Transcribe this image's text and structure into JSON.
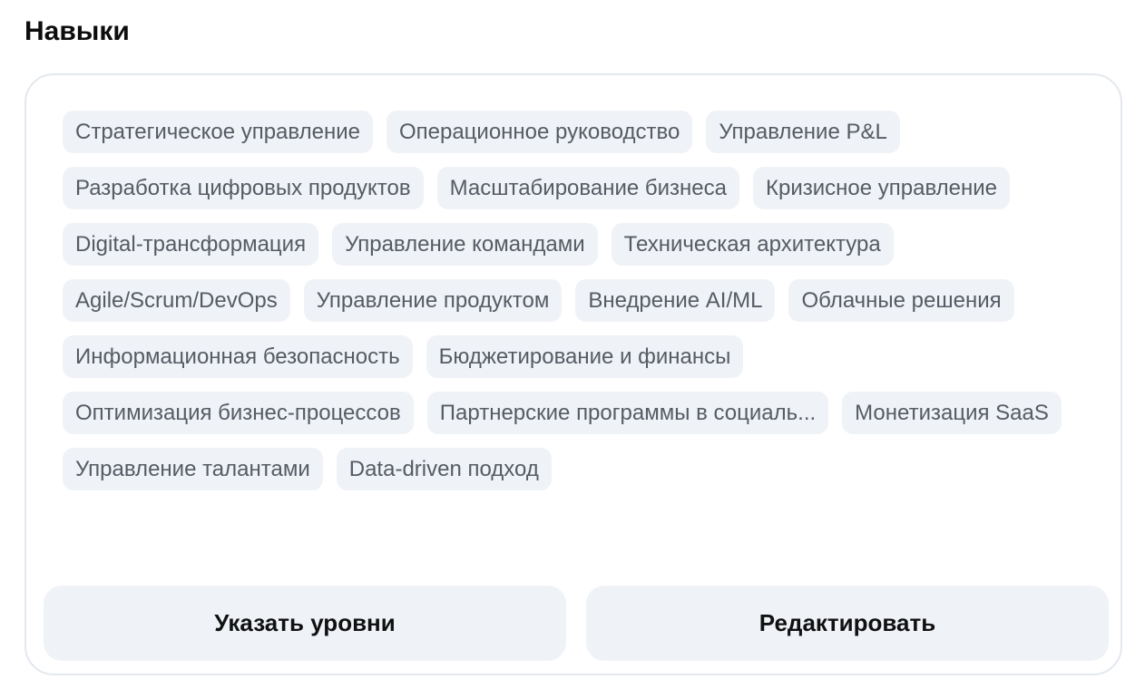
{
  "section": {
    "title": "Навыки"
  },
  "skills": [
    "Стратегическое управление",
    "Операционное руководство",
    "Управление P&L",
    "Разработка цифровых продуктов",
    "Масштабирование бизнеса",
    "Кризисное управление",
    "Digital-трансформация",
    "Управление командами",
    "Техническая архитектура",
    "Agile/Scrum/DevOps",
    "Управление продуктом",
    "Внедрение AI/ML",
    "Облачные решения",
    "Информационная безопасность",
    "Бюджетирование и финансы",
    "Оптимизация бизнес-процессов",
    "Партнерские программы в социаль...",
    "Монетизация SaaS",
    "Управление талантами",
    "Data-driven подход"
  ],
  "actions": {
    "set_levels_label": "Указать уровни",
    "edit_label": "Редактировать"
  }
}
